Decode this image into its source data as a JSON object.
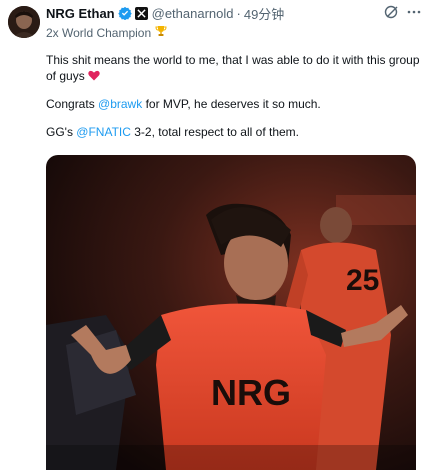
{
  "author": {
    "display_name": "NRG Ethan",
    "handle": "@ethanarnold",
    "time": "49分钟",
    "bio": "2x World Champion",
    "verified_icon": "verified-badge-icon",
    "affiliate_icon": "twitter-x-affiliate-icon"
  },
  "tweet": {
    "line1": "This shit means the world to me, that I was able to do it with this group of guys",
    "line2_prefix": "Congrats ",
    "line2_mention": "@brawk",
    "line2_suffix": " for MVP, he deserves it so much.",
    "line3_prefix": "GG's ",
    "line3_mention": "@FNATIC",
    "line3_suffix": " 3-2, total respect to all of them."
  },
  "media": {
    "jersey_text": "NRG",
    "background_jersey_number": "25"
  },
  "colors": {
    "link": "#1d9bf0",
    "heart": "#e0245e",
    "secondary_text": "#536471"
  }
}
